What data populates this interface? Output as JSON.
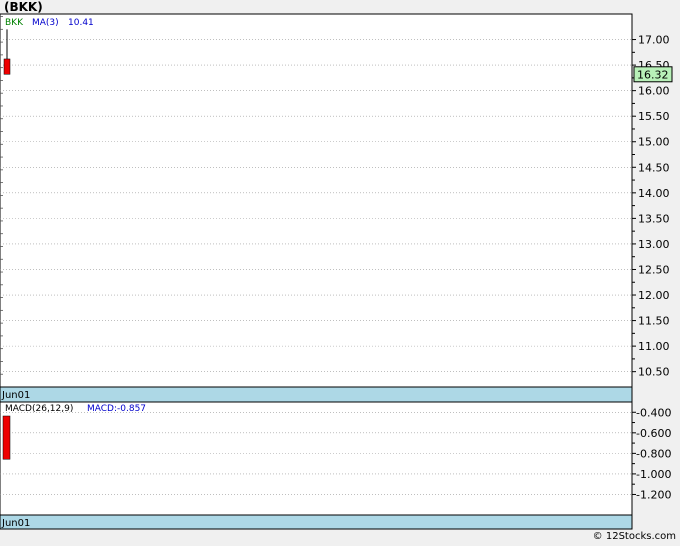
{
  "header": {
    "title": "(BKK)"
  },
  "footer": {
    "credit": "© 12Stocks.com"
  },
  "colors": {
    "up": "#00cc00",
    "down": "#ee0000",
    "band": "#add8e6",
    "price_badge": "#b8f0b8"
  },
  "chart_data": [
    {
      "type": "candlestick",
      "ticker": "BKK",
      "legend": {
        "ticker": "BKK",
        "ma_label": "MA(3)",
        "ma_value": "10.41"
      },
      "x_label": "Jun01",
      "ylim": [
        10.2,
        17.5
      ],
      "y_ticks": [
        "17.00",
        "16.50",
        "16.00",
        "15.50",
        "15.00",
        "14.50",
        "14.00",
        "13.50",
        "13.00",
        "12.50",
        "12.00",
        "11.50",
        "11.00",
        "10.50"
      ],
      "y_tick_values": [
        17.0,
        16.5,
        16.0,
        15.5,
        15.0,
        14.5,
        14.0,
        13.5,
        13.0,
        12.5,
        12.0,
        11.5,
        11.0,
        10.5
      ],
      "last_price": "16.32",
      "last_price_value": 16.32,
      "candles": [
        {
          "date": "Jun01",
          "open": 16.62,
          "high": 17.2,
          "low": 16.32,
          "close": 16.32
        }
      ],
      "grid": true
    },
    {
      "type": "bar",
      "indicator": "MACD",
      "legend": {
        "label": "MACD(26,12,9)",
        "value_label": "MACD:-0.857"
      },
      "x_label": "Jun01",
      "ylim": [
        -1.4,
        -0.3
      ],
      "y_ticks": [
        "-0.400",
        "-0.600",
        "-0.800",
        "-1.000",
        "-1.200"
      ],
      "y_tick_values": [
        -0.4,
        -0.6,
        -0.8,
        -1.0,
        -1.2
      ],
      "values": [
        {
          "date": "Jun01",
          "value": -0.857
        }
      ],
      "grid": true
    }
  ]
}
